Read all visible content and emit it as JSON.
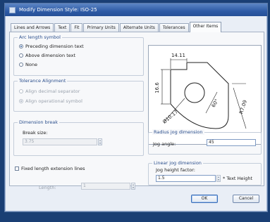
{
  "window": {
    "title": "Modify Dimension Style: ISO-25"
  },
  "tabs": [
    {
      "label": "Lines and Arrows"
    },
    {
      "label": "Text"
    },
    {
      "label": "Fit"
    },
    {
      "label": "Primary Units"
    },
    {
      "label": "Alternate Units"
    },
    {
      "label": "Tolerances"
    },
    {
      "label": "Other Items"
    }
  ],
  "arc_length": {
    "legend": "Arc length symbol",
    "options": [
      {
        "label": "Preceding dimension text",
        "checked": true
      },
      {
        "label": "Above dimension text",
        "checked": false
      },
      {
        "label": "None",
        "checked": false
      }
    ]
  },
  "tolerance": {
    "legend": "Tolerance Alignment",
    "options": [
      {
        "label": "Align decimal separator",
        "checked": false
      },
      {
        "label": "Align operational symbol",
        "checked": true
      }
    ]
  },
  "dimension_break": {
    "legend": "Dimension break",
    "size_label": "Break size:",
    "size_value": "3.75"
  },
  "fixed_length": {
    "label": "Fixed length extension lines",
    "length_label": "Length:",
    "length_value": "1"
  },
  "radius_jog": {
    "legend": "Radius jog dimension",
    "angle_label": "Jog angle:",
    "angle_value": "45"
  },
  "linear_jog": {
    "legend": "Linear jog dimension",
    "height_label": "Jog height factor:",
    "height_value": "1.5",
    "suffix": "* Text Height"
  },
  "preview": {
    "dim_top": "14.11",
    "dim_left": "16.6",
    "dim_right": "R7.09",
    "dim_angle": "60°",
    "dim_dia": "Ø10.17"
  },
  "buttons": {
    "ok": "OK",
    "cancel": "Cancel"
  },
  "colors": {
    "title_bar": "#2e5ba6",
    "group_legend": "#2a4e8c",
    "desktop": "#1a3f74"
  }
}
